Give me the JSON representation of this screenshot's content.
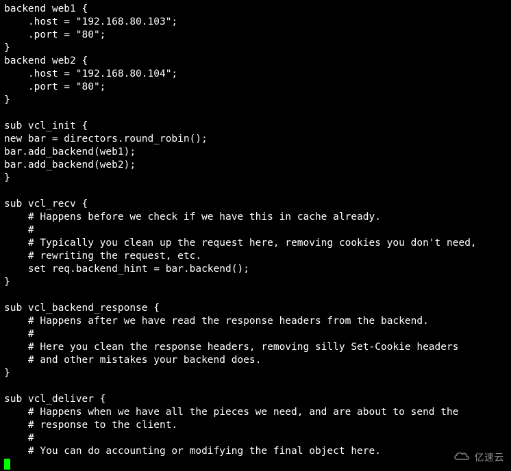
{
  "code": {
    "lines": [
      "backend web1 {",
      "    .host = \"192.168.80.103\";",
      "    .port = \"80\";",
      "}",
      "backend web2 {",
      "    .host = \"192.168.80.104\";",
      "    .port = \"80\";",
      "}",
      "",
      "sub vcl_init {",
      "new bar = directors.round_robin();",
      "bar.add_backend(web1);",
      "bar.add_backend(web2);",
      "}",
      "",
      "sub vcl_recv {",
      "    # Happens before we check if we have this in cache already.",
      "    #",
      "    # Typically you clean up the request here, removing cookies you don't need,",
      "    # rewriting the request, etc.",
      "    set req.backend_hint = bar.backend();",
      "}",
      "",
      "sub vcl_backend_response {",
      "    # Happens after we have read the response headers from the backend.",
      "    #",
      "    # Here you clean the response headers, removing silly Set-Cookie headers",
      "    # and other mistakes your backend does.",
      "}",
      "",
      "sub vcl_deliver {",
      "    # Happens when we have all the pieces we need, and are about to send the",
      "    # response to the client.",
      "    #",
      "    # You can do accounting or modifying the final object here."
    ]
  },
  "watermark": {
    "text": "亿速云",
    "icon": "cloud-icon"
  }
}
